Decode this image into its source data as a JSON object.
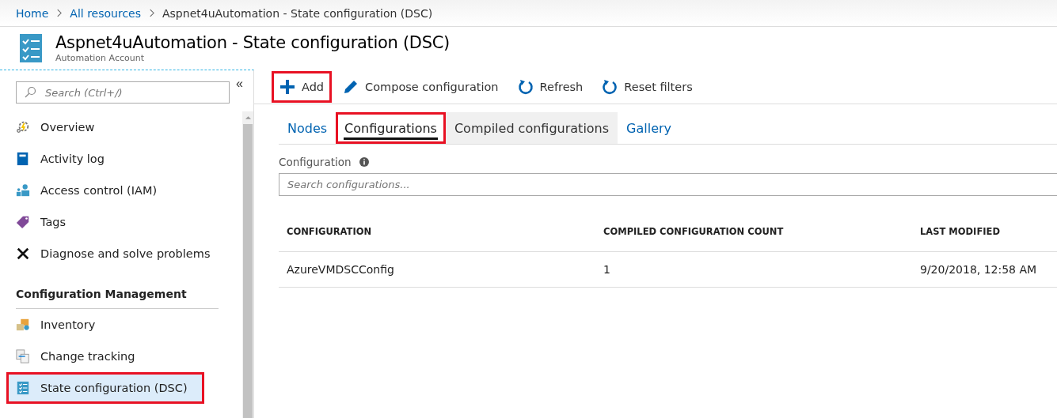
{
  "breadcrumb": [
    {
      "label": "Home",
      "link": true
    },
    {
      "label": "All resources",
      "link": true
    },
    {
      "label": "Aspnet4uAutomation - State configuration (DSC)",
      "link": false
    }
  ],
  "header": {
    "title": "Aspnet4uAutomation - State configuration (DSC)",
    "subtitle": "Automation Account"
  },
  "sidebar": {
    "search": {
      "placeholder": "Search (Ctrl+/)"
    },
    "collapse_glyph": "«",
    "items": [
      {
        "kind": "item",
        "label": "Overview",
        "selected": false,
        "highlighted": false
      },
      {
        "kind": "item",
        "label": "Activity log",
        "selected": false,
        "highlighted": false
      },
      {
        "kind": "item",
        "label": "Access control (IAM)",
        "selected": false,
        "highlighted": false
      },
      {
        "kind": "item",
        "label": "Tags",
        "selected": false,
        "highlighted": false
      },
      {
        "kind": "item",
        "label": "Diagnose and solve problems",
        "selected": false,
        "highlighted": false
      },
      {
        "kind": "section",
        "label": "Configuration Management"
      },
      {
        "kind": "item",
        "label": "Inventory",
        "selected": false,
        "highlighted": false
      },
      {
        "kind": "item",
        "label": "Change tracking",
        "selected": false,
        "highlighted": false
      },
      {
        "kind": "item",
        "label": "State configuration (DSC)",
        "selected": true,
        "highlighted": true
      }
    ]
  },
  "toolbar": [
    {
      "label": "Add",
      "highlighted": true
    },
    {
      "label": "Compose configuration",
      "highlighted": false
    },
    {
      "label": "Refresh",
      "highlighted": false
    },
    {
      "label": "Reset filters",
      "highlighted": false
    }
  ],
  "tabs": [
    {
      "label": "Nodes",
      "selected": false,
      "hovered": false,
      "highlighted": false
    },
    {
      "label": "Configurations",
      "selected": true,
      "hovered": false,
      "highlighted": true
    },
    {
      "label": "Compiled configurations",
      "selected": false,
      "hovered": true,
      "highlighted": false
    },
    {
      "label": "Gallery",
      "selected": false,
      "hovered": false,
      "highlighted": false
    }
  ],
  "filter": {
    "label": "Configuration",
    "placeholder": "Search configurations..."
  },
  "table": {
    "columns": [
      "CONFIGURATION",
      "COMPILED CONFIGURATION COUNT",
      "LAST MODIFIED"
    ],
    "rows": [
      [
        "AzureVMDSCConfig",
        "1",
        "9/20/2018, 12:58 AM"
      ]
    ]
  }
}
